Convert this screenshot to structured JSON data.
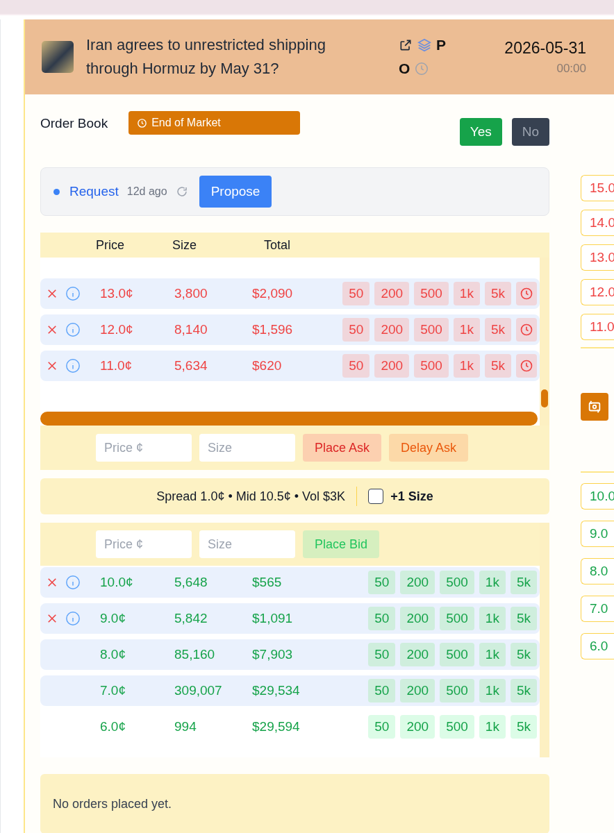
{
  "header": {
    "title": "Iran agrees to unrestricted shipping through Hormuz by May 31?",
    "badges": [
      "P",
      "O"
    ],
    "date": "2026-05-31",
    "time": "00:00"
  },
  "order_book": {
    "title": "Order Book",
    "status": "End of Market",
    "outcomes": [
      {
        "label": "Yes",
        "selected": true
      },
      {
        "label": "No",
        "selected": false
      }
    ]
  },
  "request": {
    "label": "Request",
    "age": "12d ago",
    "button": "Propose"
  },
  "columns": [
    "Price",
    "Size",
    "Total"
  ],
  "asks": {
    "kind": "ask",
    "rows": [
      {
        "price": "13.0¢",
        "size": "3,800",
        "total": "$2,090",
        "own_order": true,
        "highlighted": true,
        "sizes": [
          "50",
          "200",
          "500",
          "1k",
          "5k"
        ]
      },
      {
        "price": "12.0¢",
        "size": "8,140",
        "total": "$1,596",
        "own_order": true,
        "highlighted": true,
        "sizes": [
          "50",
          "200",
          "500",
          "1k",
          "5k"
        ]
      },
      {
        "price": "11.0¢",
        "size": "5,634",
        "total": "$620",
        "own_order": true,
        "highlighted": true,
        "sizes": [
          "50",
          "200",
          "500",
          "1k",
          "5k"
        ]
      }
    ]
  },
  "ask_form": {
    "price_placeholder": "Price ¢",
    "size_placeholder": "Size",
    "buttons": [
      {
        "label": "Place Ask",
        "kind": "place"
      },
      {
        "label": "Delay Ask",
        "kind": "delay"
      }
    ]
  },
  "summary": {
    "text": "Spread 1.0¢ • Mid 10.5¢ • Vol $3K",
    "checkbox": {
      "label": "+1 Size",
      "checked": false
    }
  },
  "bid_form": {
    "price_placeholder": "Price ¢",
    "size_placeholder": "Size",
    "buttons": [
      {
        "label": "Place Bid",
        "kind": "bid"
      }
    ]
  },
  "bids": {
    "kind": "bid",
    "rows": [
      {
        "price": "10.0¢",
        "size": "5,648",
        "total": "$565",
        "own_order": true,
        "highlighted": true,
        "sizes": [
          "50",
          "200",
          "500",
          "1k",
          "5k"
        ]
      },
      {
        "price": "9.0¢",
        "size": "5,842",
        "total": "$1,091",
        "own_order": true,
        "highlighted": true,
        "sizes": [
          "50",
          "200",
          "500",
          "1k",
          "5k"
        ]
      },
      {
        "price": "8.0¢",
        "size": "85,160",
        "total": "$7,903",
        "own_order": false,
        "highlighted": true,
        "sizes": [
          "50",
          "200",
          "500",
          "1k",
          "5k"
        ]
      },
      {
        "price": "7.0¢",
        "size": "309,007",
        "total": "$29,534",
        "own_order": false,
        "highlighted": true,
        "sizes": [
          "50",
          "200",
          "500",
          "1k",
          "5k"
        ]
      },
      {
        "price": "6.0¢",
        "size": "994",
        "total": "$29,594",
        "own_order": false,
        "highlighted": false,
        "sizes": [
          "50",
          "200",
          "500",
          "1k",
          "5k"
        ]
      }
    ]
  },
  "orders_message": "No orders placed yet.",
  "side_ladder": {
    "asks": [
      "15.0",
      "14.0",
      "13.0",
      "12.0",
      "11.0"
    ],
    "bids": [
      "10.0",
      "9.0",
      "8.0",
      "7.0",
      "6.0"
    ]
  }
}
